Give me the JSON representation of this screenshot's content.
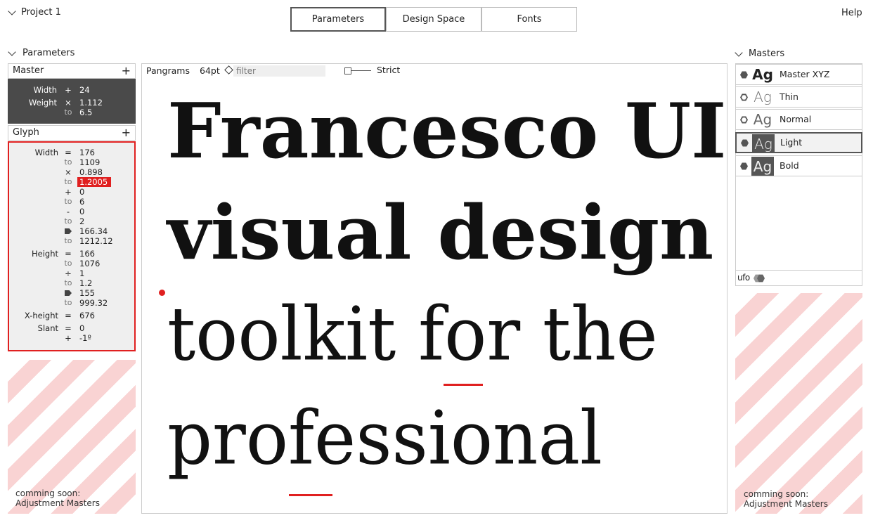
{
  "project": {
    "label": "Project 1"
  },
  "tabs": [
    {
      "label": "Parameters",
      "active": true
    },
    {
      "label": "Design Space",
      "active": false
    },
    {
      "label": "Fonts",
      "active": false
    }
  ],
  "help_label": "Help",
  "parameters": {
    "header": "Parameters",
    "master_section": {
      "title": "Master",
      "rows": [
        {
          "label": "Width",
          "op": "+",
          "value": "24"
        },
        {
          "label": "Weight",
          "op": "×",
          "value": "1.112"
        },
        {
          "label": "",
          "op": "to",
          "value": "6.5"
        }
      ]
    },
    "glyph_section": {
      "title": "Glyph",
      "rows": [
        {
          "label": "Width",
          "op": "=",
          "value": "176"
        },
        {
          "label": "",
          "op": "to",
          "value": "1109"
        },
        {
          "label": "",
          "op": "×",
          "value": "0.898"
        },
        {
          "label": "",
          "op": "to",
          "value": "1.2005",
          "highlight": true
        },
        {
          "label": "",
          "op": "+",
          "value": "0"
        },
        {
          "label": "",
          "op": "to",
          "value": "6"
        },
        {
          "label": "",
          "op": "-",
          "value": "0"
        },
        {
          "label": "",
          "op": "to",
          "value": "2"
        },
        {
          "label": "",
          "op": "tag-icon",
          "value": "166.34"
        },
        {
          "label": "",
          "op": "to",
          "value": "1212.12"
        },
        {
          "label": "Height",
          "op": "=",
          "value": "166"
        },
        {
          "label": "",
          "op": "to",
          "value": "1076"
        },
        {
          "label": "",
          "op": "÷",
          "value": "1"
        },
        {
          "label": "",
          "op": "to",
          "value": "1.2"
        },
        {
          "label": "",
          "op": "tag-icon",
          "value": "155"
        },
        {
          "label": "",
          "op": "to",
          "value": "999.32"
        },
        {
          "label": "X-height",
          "op": "=",
          "value": "676"
        },
        {
          "label": "Slant",
          "op": "=",
          "value": "0"
        },
        {
          "label": "",
          "op": "+",
          "value": "-1º"
        }
      ]
    },
    "coming_soon": {
      "line1": "comming soon:",
      "line2": "Adjustment Masters"
    }
  },
  "canvas": {
    "mode_label": "Pangrams",
    "size_label": "64pt",
    "filter_placeholder": "filter",
    "strict_label": "Strict",
    "lines": [
      "Francesco UI",
      "visual design",
      "toolkit for the",
      "professional"
    ]
  },
  "masters": {
    "header": "Masters",
    "items": [
      {
        "name": "Master XYZ",
        "sample": "Ag",
        "style": "bold",
        "icon": "filled",
        "selected": false
      },
      {
        "name": "Thin",
        "sample": "Ag",
        "style": "thin",
        "icon": "outline",
        "selected": false
      },
      {
        "name": "Normal",
        "sample": "Ag",
        "style": "normal",
        "icon": "outline",
        "selected": false
      },
      {
        "name": "Light",
        "sample": "Ag",
        "style": "light-dark",
        "icon": "filled",
        "selected": true
      },
      {
        "name": "Bold",
        "sample": "Ag",
        "style": "bold-dark",
        "icon": "filled",
        "selected": false
      }
    ],
    "footer_label": "ufo",
    "coming_soon": {
      "line1": "comming soon:",
      "line2": "Adjustment Masters"
    }
  },
  "colors": {
    "accent": "#e02020",
    "dark_panel": "#4a4a4a",
    "stripe": "#f9d3d3"
  }
}
